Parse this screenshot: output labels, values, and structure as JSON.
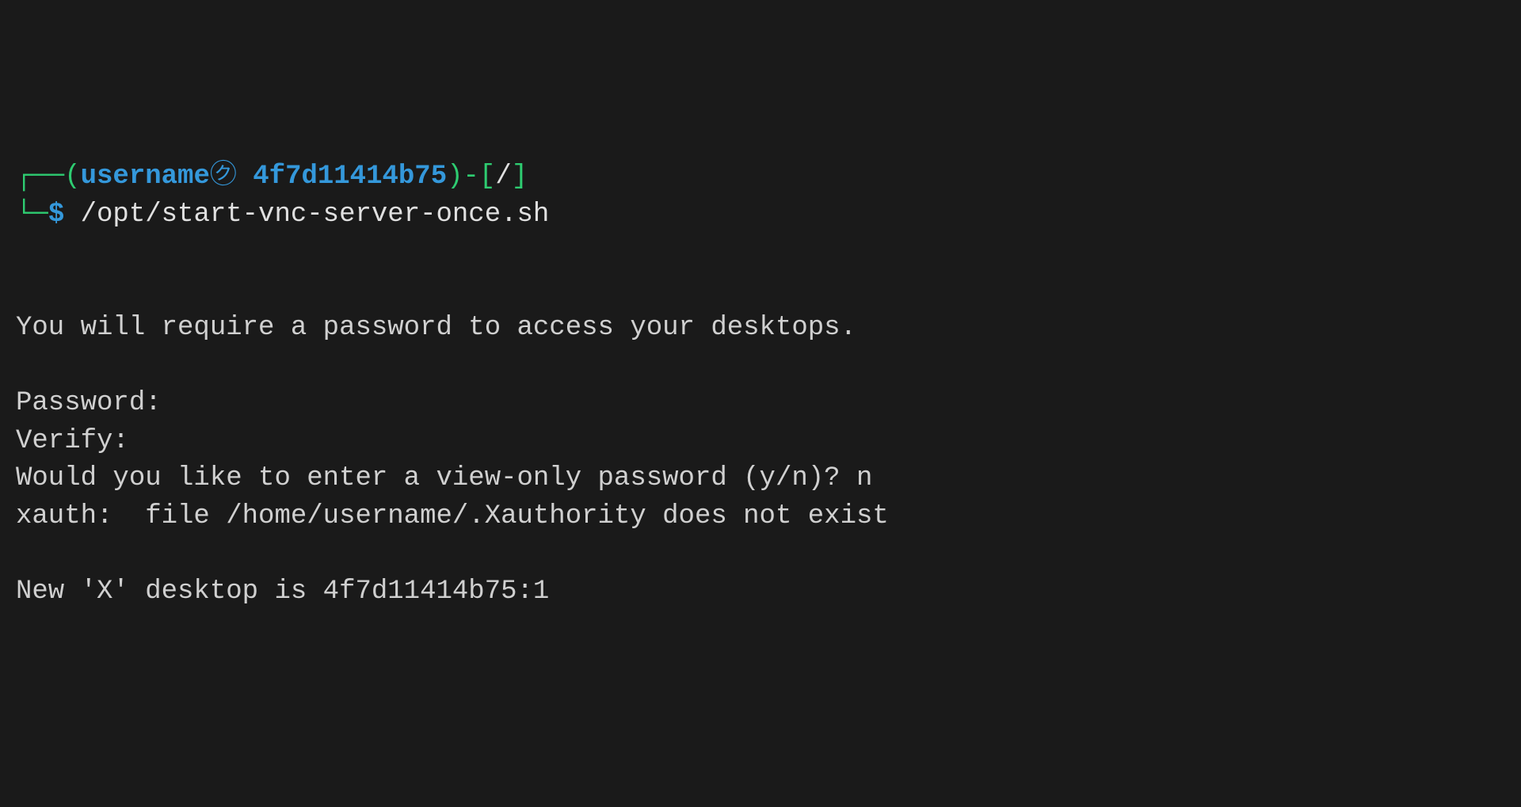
{
  "prompt": {
    "line1_open": "┌──(",
    "username": "username",
    "circled_symbol": "㋗",
    "hostname": " 4f7d11414b75",
    "line1_close": ")-[",
    "cwd": "/",
    "line1_end": "]",
    "line2_connector": "└─",
    "dollar": "$ ",
    "command": "/opt/start-vnc-server-once.sh"
  },
  "output": {
    "blank1": "",
    "line1": "You will require a password to access your desktops.",
    "blank2": "",
    "line2": "Password:",
    "line3": "Verify:",
    "line4": "Would you like to enter a view-only password (y/n)? n",
    "line5": "xauth:  file /home/username/.Xauthority does not exist",
    "blank3": "",
    "line6": "New 'X' desktop is 4f7d11414b75:1"
  }
}
